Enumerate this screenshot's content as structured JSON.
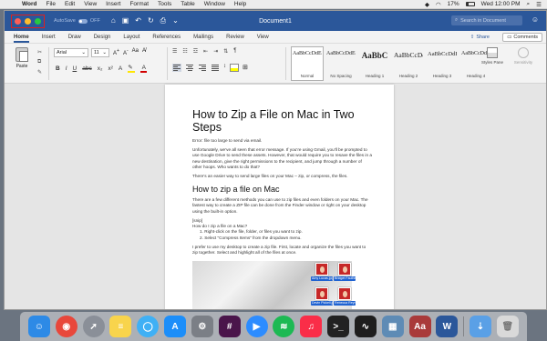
{
  "menubar": {
    "items": [
      "Word",
      "File",
      "Edit",
      "View",
      "Insert",
      "Format",
      "Tools",
      "Table",
      "Window",
      "Help"
    ],
    "battery": "17%",
    "clock": "Wed 12:00 PM"
  },
  "titlebar": {
    "autosave_label": "AutoSave",
    "autosave_state": "OFF",
    "document_title": "Document1",
    "search_placeholder": "Search in Document"
  },
  "ribbon_tabs": [
    "Home",
    "Insert",
    "Draw",
    "Design",
    "Layout",
    "References",
    "Mailings",
    "Review",
    "View"
  ],
  "active_tab": "Home",
  "share_label": "Share",
  "comments_label": "Comments",
  "ribbon": {
    "paste_label": "Paste",
    "font_name": "Arial",
    "font_size": "11",
    "styles": [
      {
        "preview": "AaBbCcDdEe",
        "name": "Normal"
      },
      {
        "preview": "AaBbCcDdEe",
        "name": "No Spacing"
      },
      {
        "preview": "AaBbC",
        "name": "Heading 1"
      },
      {
        "preview": "AaBbCcDc",
        "name": "Heading 2"
      },
      {
        "preview": "AaBbCcDdE",
        "name": "Heading 3"
      },
      {
        "preview": "AaBbCcDdEe",
        "name": "Heading 4"
      }
    ],
    "styles_pane_label": "Styles Pane",
    "sensitivity_label": "Sensitivity"
  },
  "document": {
    "title": "How to Zip a File on Mac in Two Steps",
    "error_line": "Error: file too large to send via email.",
    "para1": "Unfortunately, we’ve all seen that error message. If you’re using Gmail, you’ll be prompted to use Google Drive to send these assets. However, that would require you to resave the files in a new destination, give the right permissions to the recipient, and jump through a number of other hoops. Who wants to do that?",
    "para2": "There’s an easier way to send large files on your Mac – zip, or compress, the files.",
    "h2": "How to zip a file on Mac",
    "para3": "There are a few different methods you can use to zip files and even folders on your Mac. The fastest way to create a ZIP file can be done from the Finder window or right on your desktop using the built-in option.",
    "snip_tag": "[snip]",
    "snip_q": "How do I zip a file on a Mac?",
    "steps": [
      "1.   Right-click on the file, folder, or files you want to zip.",
      "2.   Select “Compress Items” from the dropdown menu."
    ],
    "para4": "I prefer to use my desktop to create a zip file. First, locate and organize the files you want to zip together. Select and highlight all of the files at once.",
    "files": [
      "Amy Lucas.jpg",
      "Bridget Fauther.jpg",
      "Devin Pickell.jpg",
      "Rebecca Reynoso.jpg",
      "",
      ""
    ]
  },
  "dock": {
    "apps": [
      "Finder",
      "Chrome",
      "Launchpad",
      "Notes",
      "Messages",
      "App Store",
      "System Preferences",
      "Slack",
      "Zoom",
      "Spotify",
      "Music",
      "Terminal",
      "Activity Monitor",
      "Preview",
      "Dictionary",
      "Word",
      "Downloads",
      "Trash"
    ],
    "colors": [
      "#2d8ae6",
      "#e8473b",
      "#8a8f98",
      "#f8d44c",
      "#3fb0f5",
      "#1c8ef9",
      "#7b7f86",
      "#4a154b",
      "#2d8cff",
      "#1db954",
      "#fa2d48",
      "#222222",
      "#1e1e1e",
      "#5e8bb5",
      "#a93a3a",
      "#2b579a",
      "#5aa0e6",
      "#d9d9d9"
    ]
  }
}
